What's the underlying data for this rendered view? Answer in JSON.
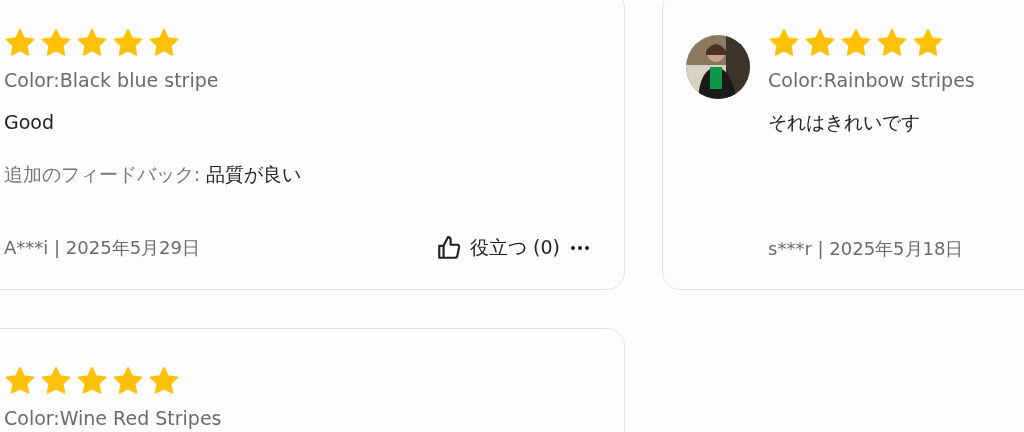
{
  "reviews": [
    {
      "stars": 5,
      "avatar": false,
      "variant": "Color:Black blue stripe",
      "text": "Good",
      "feedback_label": "追加のフィードバック:",
      "feedback_value": "品質が良い",
      "author_date": "A***i | 2025年5月29日",
      "helpful": "役立つ (0)"
    },
    {
      "stars": 5,
      "avatar": true,
      "variant": "Color:Rainbow stripes",
      "text": "それはきれいです",
      "author_date": "s***r | 2025年5月18日"
    },
    {
      "stars": 5,
      "avatar": false,
      "variant": "Color:Wine Red Stripes"
    }
  ]
}
